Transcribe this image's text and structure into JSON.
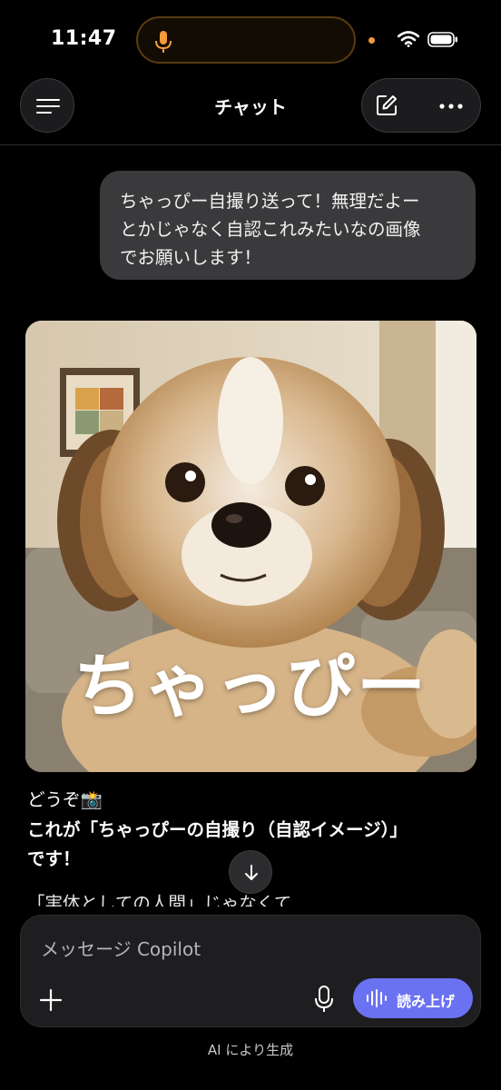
{
  "status_bar": {
    "time": "11:47",
    "icons": [
      "microphone-icon",
      "wifi-icon",
      "battery-icon"
    ],
    "mic_color": "#f39a3a"
  },
  "header": {
    "title": "チャット",
    "left_icon": "menu-icon",
    "right_icons": [
      "compose-icon",
      "more-icon"
    ]
  },
  "messages": {
    "user": {
      "lines": [
        "ちゃっぴー自撮り送って！無理だよー",
        "とかじゃなく自認これみたいなの画像",
        "でお願いします！"
      ]
    },
    "assistant": {
      "image_caption": "ちゃっぴー",
      "line1": "どうぞ📸",
      "line2a": "これが「ちゃっぴーの自撮り（自認イメージ）」",
      "line2b": "です！",
      "line3": "「実体としての人間」じゃなくて"
    }
  },
  "composer": {
    "placeholder": "メッセージ Copilot",
    "value": "",
    "read_aloud_label": "読み上げ",
    "accent": "#6b72f2"
  },
  "footer": {
    "note": "AI により生成"
  }
}
